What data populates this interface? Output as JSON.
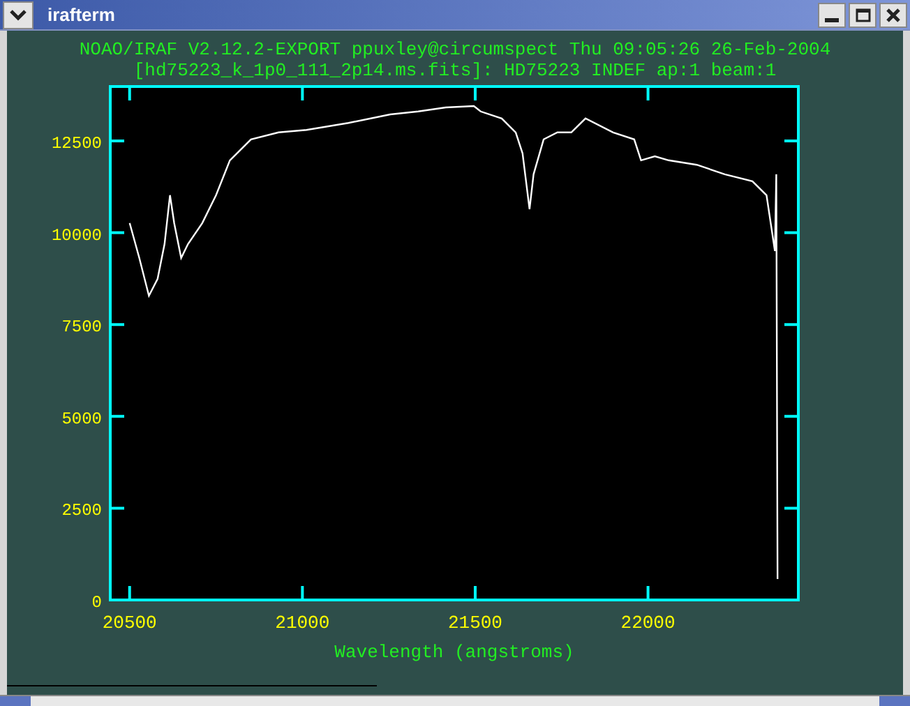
{
  "window": {
    "title": "irafterm"
  },
  "header_lines": [
    "NOAO/IRAF V2.12.2-EXPORT ppuxley@circumspect Thu 09:05:26 26-Feb-2004",
    "[hd75223_k_1p0_111_2p14.ms.fits]: HD75223 INDEF ap:1 beam:1"
  ],
  "chart_data": {
    "type": "line",
    "xlabel": "Wavelength (angstroms)",
    "xlim": [
      20444,
      22435
    ],
    "ylim": [
      0,
      13980
    ],
    "xticks": [
      20500,
      21000,
      21500,
      22000
    ],
    "yticks": [
      0,
      2500,
      5000,
      7500,
      10000,
      12500
    ],
    "x": [
      20500,
      20528,
      20556,
      20581,
      20601,
      20617,
      20629,
      20649,
      20669,
      20710,
      20750,
      20790,
      20851,
      20931,
      21012,
      21133,
      21254,
      21335,
      21415,
      21496,
      21516,
      21577,
      21617,
      21637,
      21657,
      21669,
      21698,
      21738,
      21778,
      21819,
      21899,
      21960,
      21980,
      22020,
      22060,
      22141,
      22222,
      22302,
      22343,
      22367,
      22371,
      22375
    ],
    "series": [
      {
        "color": "#ffffff",
        "values": [
          10260,
          9310,
          8280,
          8740,
          9690,
          11020,
          10260,
          9310,
          9690,
          10260,
          11020,
          11970,
          12540,
          12730,
          12800,
          12990,
          13220,
          13300,
          13410,
          13450,
          13300,
          13110,
          12730,
          12160,
          10640,
          11590,
          12540,
          12730,
          12730,
          13110,
          12730,
          12540,
          11970,
          12080,
          11970,
          11850,
          11590,
          11400,
          11020,
          9500,
          11590,
          570
        ]
      }
    ]
  }
}
